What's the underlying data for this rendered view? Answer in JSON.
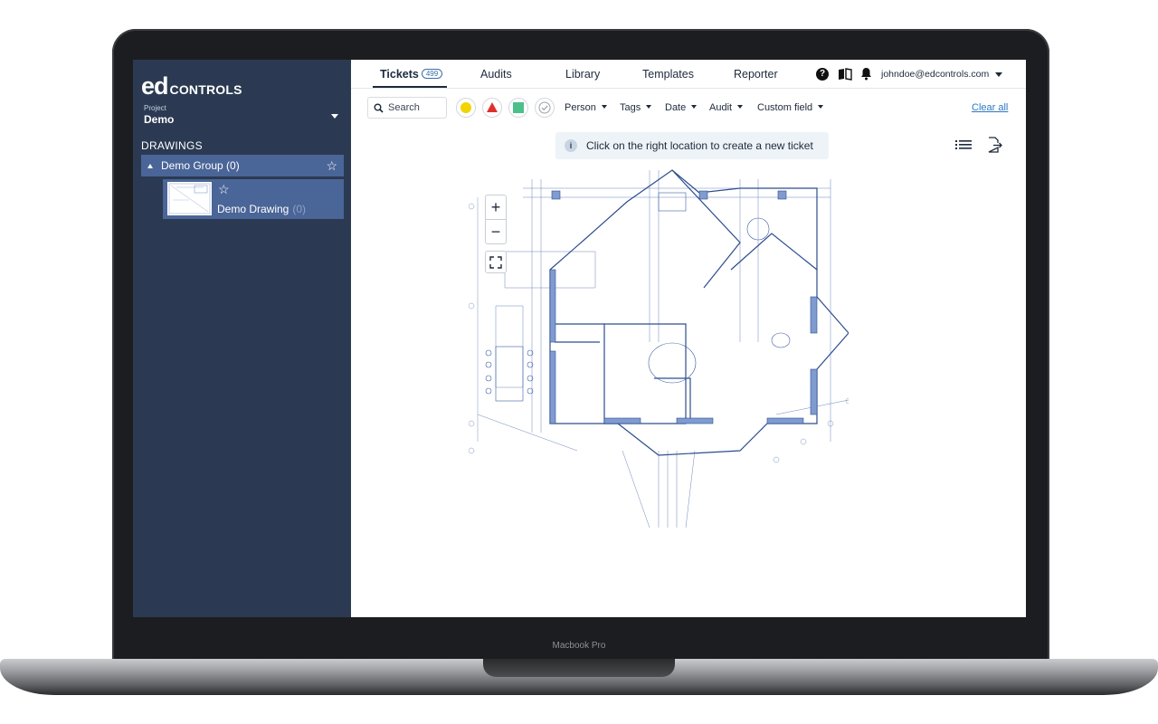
{
  "sidebar": {
    "logo_mark": "ed",
    "logo_word": "CONTROLS",
    "project_caption": "Project",
    "project_name": "Demo",
    "section_title": "DRAWINGS",
    "group": {
      "label": "Demo Group (0)"
    },
    "drawing": {
      "label": "Demo Drawing",
      "count": "(0)"
    }
  },
  "nav": {
    "tabs": [
      {
        "label": "Tickets",
        "badge": "499"
      },
      {
        "label": "Audits"
      },
      {
        "label": "Library"
      },
      {
        "label": "Templates"
      },
      {
        "label": "Reporter"
      }
    ],
    "help_glyph": "?",
    "user_email": "johndoe@edcontrols.com"
  },
  "filters": {
    "search_placeholder": "Search",
    "status_colors": {
      "open": "#f2d400",
      "urgent": "#e0302c",
      "done": "#4cc08a"
    },
    "dropdowns": [
      "Person",
      "Tags",
      "Date",
      "Audit",
      "Custom field"
    ],
    "clear_all": "Clear all"
  },
  "notice": {
    "icon_glyph": "i",
    "text": "Click on the right location to create a new ticket"
  },
  "zoom": {
    "in": "+",
    "out": "−"
  },
  "laptop_brand": "Macbook Pro",
  "icons": [
    "search-icon",
    "help-icon",
    "book-icon",
    "bell-icon",
    "list-icon",
    "export-icon",
    "fit-screen-icon",
    "star-icon",
    "info-icon"
  ]
}
